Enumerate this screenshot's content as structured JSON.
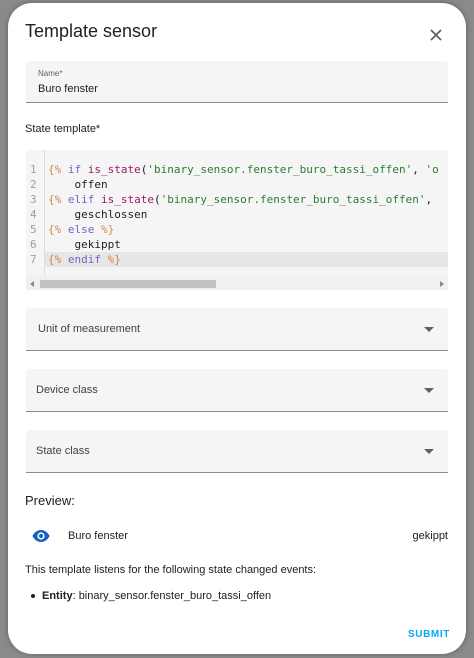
{
  "dialog": {
    "title": "Template sensor",
    "close_icon": "close-icon"
  },
  "name_field": {
    "label": "Name*",
    "value": "Buro fenster"
  },
  "state_template": {
    "label": "State template*",
    "lines": [
      {
        "n": "1",
        "tokens": [
          {
            "t": "{%",
            "c": "delim"
          },
          {
            "t": " ",
            "c": "txt"
          },
          {
            "t": "if",
            "c": "kw"
          },
          {
            "t": " ",
            "c": "txt"
          },
          {
            "t": "is_state",
            "c": "fn"
          },
          {
            "t": "(",
            "c": "txt"
          },
          {
            "t": "'binary_sensor.fenster_buro_tassi_offen'",
            "c": "str"
          },
          {
            "t": ", ",
            "c": "txt"
          },
          {
            "t": "'o",
            "c": "str"
          }
        ]
      },
      {
        "n": "2",
        "tokens": [
          {
            "t": "    offen",
            "c": "txt"
          }
        ]
      },
      {
        "n": "3",
        "tokens": [
          {
            "t": "{%",
            "c": "delim"
          },
          {
            "t": " ",
            "c": "txt"
          },
          {
            "t": "elif",
            "c": "kw"
          },
          {
            "t": " ",
            "c": "txt"
          },
          {
            "t": "is_state",
            "c": "fn"
          },
          {
            "t": "(",
            "c": "txt"
          },
          {
            "t": "'binary_sensor.fenster_buro_tassi_offen'",
            "c": "str"
          },
          {
            "t": ",",
            "c": "txt"
          }
        ]
      },
      {
        "n": "4",
        "tokens": [
          {
            "t": "    geschlossen",
            "c": "txt"
          }
        ]
      },
      {
        "n": "5",
        "tokens": [
          {
            "t": "{%",
            "c": "delim"
          },
          {
            "t": " ",
            "c": "txt"
          },
          {
            "t": "else",
            "c": "kw"
          },
          {
            "t": " ",
            "c": "txt"
          },
          {
            "t": "%}",
            "c": "delim"
          }
        ]
      },
      {
        "n": "6",
        "tokens": [
          {
            "t": "    gekippt",
            "c": "txt"
          }
        ]
      },
      {
        "n": "7",
        "tokens": [
          {
            "t": "{%",
            "c": "delim"
          },
          {
            "t": " ",
            "c": "txt"
          },
          {
            "t": "endif",
            "c": "kw"
          },
          {
            "t": " ",
            "c": "txt"
          },
          {
            "t": "%}",
            "c": "delim"
          }
        ]
      }
    ]
  },
  "unit_field": {
    "label": "Unit of measurement"
  },
  "device_class_field": {
    "label": "Device class"
  },
  "state_class_field": {
    "label": "State class"
  },
  "preview": {
    "label": "Preview:",
    "icon": "eye-icon",
    "entity_name": "Buro fenster",
    "state": "gekippt",
    "listen_text": "This template listens for the following state changed events:",
    "entity_label": "Entity",
    "entity_sep": ":",
    "entity_id": "binary_sensor.fenster_buro_tassi_offen"
  },
  "actions": {
    "submit_label": "SUBMIT"
  },
  "colors": {
    "accent": "#03a9f4",
    "eye_icon": "#1565c0",
    "code_delim": "#d08a3c",
    "code_keyword": "#7b61c6",
    "code_function": "#a1166b",
    "code_string": "#2e7d32"
  }
}
